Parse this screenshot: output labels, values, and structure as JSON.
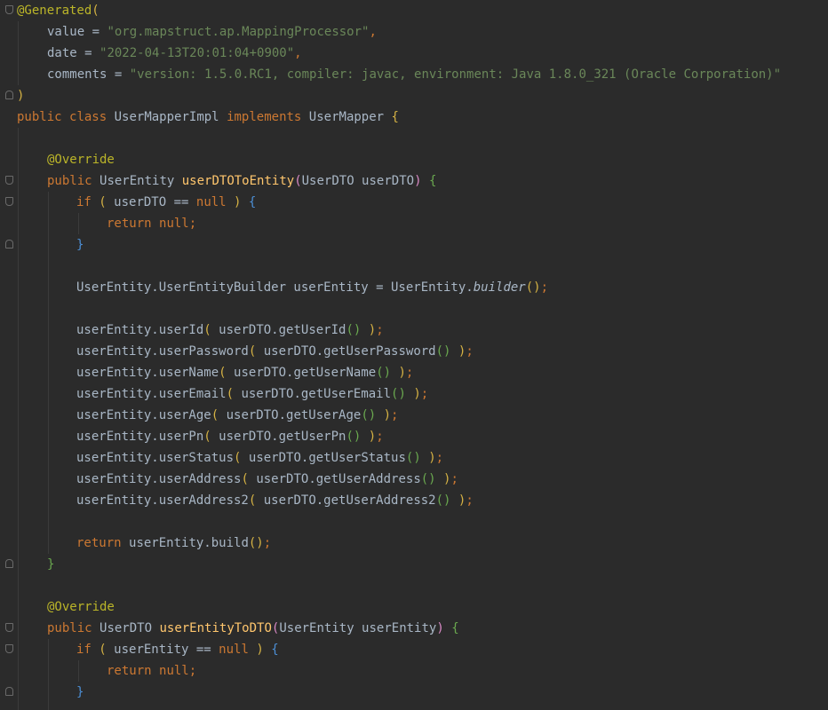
{
  "code": {
    "generated": {
      "annotation": "@Generated",
      "open_paren": "(",
      "value_key": "value",
      "value_eq": " = ",
      "value_str": "\"org.mapstruct.ap.MappingProcessor\"",
      "comma1": ",",
      "date_key": "date",
      "date_eq": " = ",
      "date_str": "\"2022-04-13T20:01:04+0900\"",
      "comma2": ",",
      "comments_key": "comments",
      "comments_eq": " = ",
      "comments_str": "\"version: 1.5.0.RC1, compiler: javac, environment: Java 1.8.0_321 (Oracle Corporation)\"",
      "close_paren": ")"
    },
    "class_decl": {
      "kw_public": "public",
      "kw_class": "class",
      "name": "UserMapperImpl",
      "kw_implements": "implements",
      "iface": "UserMapper",
      "brace": "{"
    },
    "method1": {
      "override": "@Override",
      "kw_public": "public",
      "return_type": "UserEntity",
      "name": "userDTOToEntity",
      "params": "UserDTO userDTO",
      "if_kw": "if",
      "if_cond": " userDTO == ",
      "null_kw": "null",
      "return_kw": "return",
      "return_null": "null",
      "builder_decl": "UserEntity.UserEntityBuilder userEntity = UserEntity.",
      "builder_call": "builder",
      "setters": [
        {
          "setter": "userEntity.userId",
          "getter": "userDTO.getUserId"
        },
        {
          "setter": "userEntity.userPassword",
          "getter": "userDTO.getUserPassword"
        },
        {
          "setter": "userEntity.userName",
          "getter": "userDTO.getUserName"
        },
        {
          "setter": "userEntity.userEmail",
          "getter": "userDTO.getUserEmail"
        },
        {
          "setter": "userEntity.userAge",
          "getter": "userDTO.getUserAge"
        },
        {
          "setter": "userEntity.userPn",
          "getter": "userDTO.getUserPn"
        },
        {
          "setter": "userEntity.userStatus",
          "getter": "userDTO.getUserStatus"
        },
        {
          "setter": "userEntity.userAddress",
          "getter": "userDTO.getUserAddress"
        },
        {
          "setter": "userEntity.userAddress2",
          "getter": "userDTO.getUserAddress2"
        }
      ],
      "final_return_kw": "return",
      "final_return_expr": "userEntity.build"
    },
    "method2": {
      "override": "@Override",
      "kw_public": "public",
      "return_type": "UserDTO",
      "name": "userEntityToDTO",
      "params": "UserEntity userEntity",
      "if_kw": "if",
      "if_cond": " userEntity == ",
      "null_kw": "null",
      "return_kw": "return",
      "return_null": "null"
    }
  },
  "colors": {
    "background": "#2b2b2b",
    "keyword": "#cc7832",
    "annotation": "#bbb529",
    "string": "#6a8759",
    "method_decl": "#ffc66d",
    "text": "#a9b7c6"
  }
}
